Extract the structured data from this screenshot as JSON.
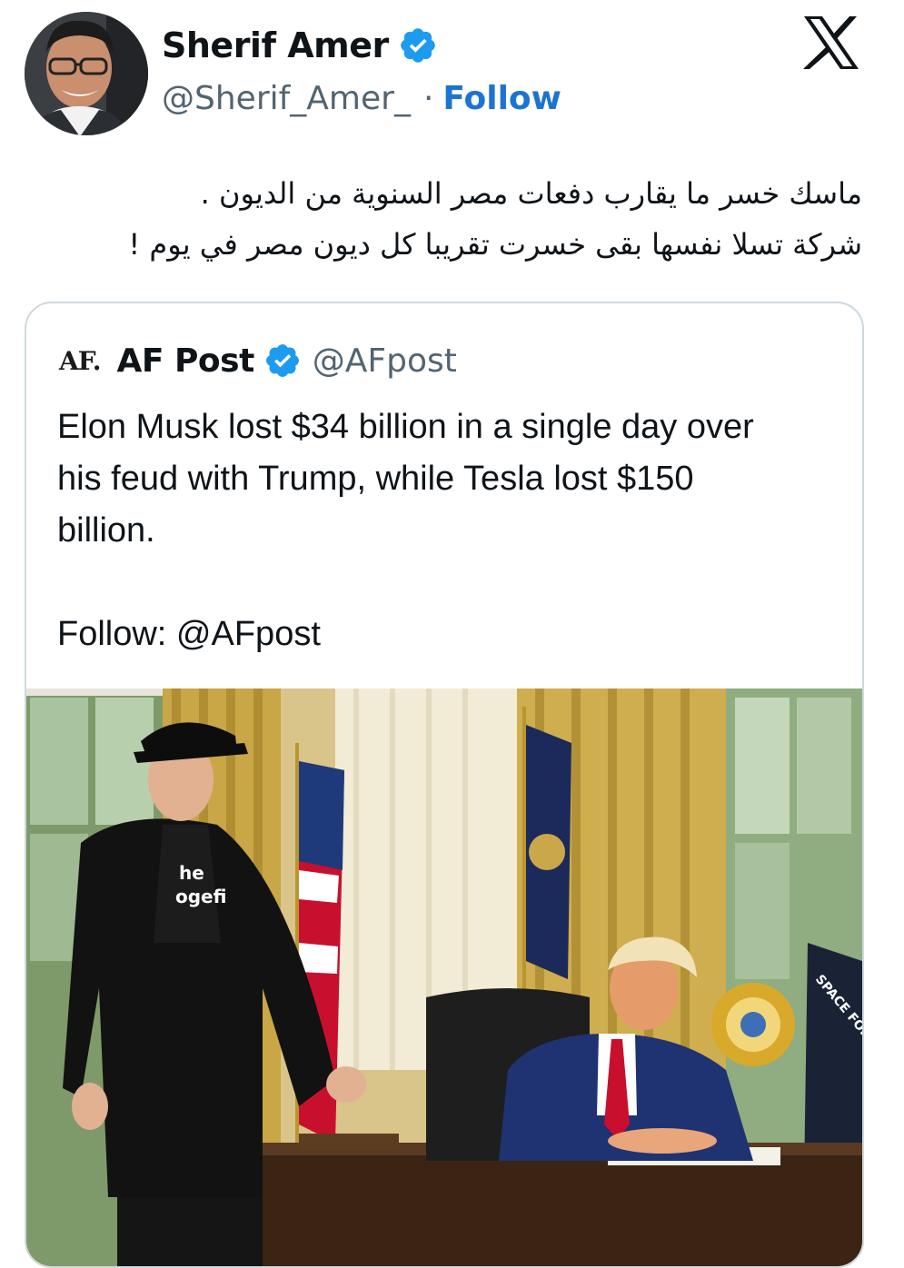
{
  "author": {
    "display_name": "Sherif Amer",
    "handle": "@Sherif_Amer_",
    "separator": "·",
    "follow_label": "Follow",
    "verified_icon": "verified-badge-icon"
  },
  "brand_icon": "x-logo-icon",
  "tweet": {
    "lines": [
      "ماسك خسر ما يقارب دفعات مصر السنوية من الديون .",
      "شركة تسلا نفسها بقى خسرت تقريبا كل ديون مصر في يوم !"
    ]
  },
  "quoted_tweet": {
    "logo_text": "AF.",
    "display_name": "AF Post",
    "handle": "@AFpost",
    "body_lines": [
      "Elon Musk lost $34 billion in a single day over",
      "his feud with Trump, while Tesla lost $150",
      "billion."
    ],
    "footer_line": "Follow: @AFpost",
    "image": {
      "shirt_text_1": "he",
      "shirt_text_2": "ogefi",
      "banner_text": "SPACE FOR"
    }
  },
  "colors": {
    "verified_blue": "#1d9bf0",
    "follow_blue": "#1d74d0",
    "text": "#0f1419",
    "muted": "#536471",
    "border": "#cfd9de"
  }
}
